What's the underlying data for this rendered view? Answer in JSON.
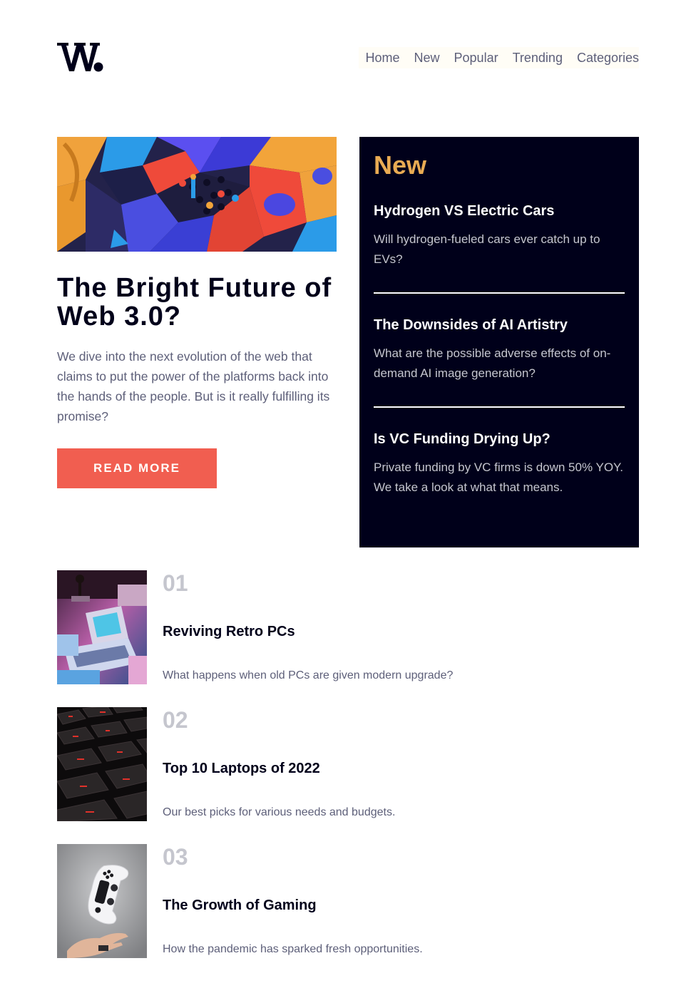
{
  "brand": {
    "logo_text": "W."
  },
  "nav": {
    "items": [
      {
        "label": "Home"
      },
      {
        "label": "New"
      },
      {
        "label": "Popular"
      },
      {
        "label": "Trending"
      },
      {
        "label": "Categories"
      }
    ]
  },
  "hero": {
    "title": "The Bright Future of Web 3.0?",
    "description": "We dive into the next evolution of the web that claims to put the power of the platforms back into the hands of the people. But is it really fulfilling its promise?",
    "button_label": "READ MORE",
    "button_color": "#f15e50"
  },
  "new_panel": {
    "heading": "New",
    "heading_color": "#e9ab53",
    "items": [
      {
        "title": "Hydrogen VS Electric Cars",
        "description": "Will hydrogen-fueled cars ever catch up to EVs?"
      },
      {
        "title": "The Downsides of AI Artistry",
        "description": "What are the possible adverse effects of on-demand AI image generation?"
      },
      {
        "title": "Is VC Funding Drying Up?",
        "description": "Private funding by VC firms is down 50% YOY. We take a look at what that means."
      }
    ]
  },
  "articles": [
    {
      "number": "01",
      "title": "Reviving Retro PCs",
      "description": "What happens when old PCs are given modern upgrade?"
    },
    {
      "number": "02",
      "title": "Top 10 Laptops of 2022",
      "description": "Our best picks for various needs and budgets."
    },
    {
      "number": "03",
      "title": "The Growth of Gaming",
      "description": "How the pandemic has sparked fresh opportunities."
    }
  ]
}
